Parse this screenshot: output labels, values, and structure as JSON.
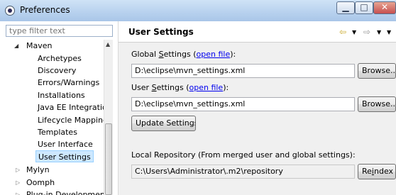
{
  "window": {
    "title": "Preferences",
    "minimize_glyph": "▁",
    "maximize_glyph": "□",
    "close_glyph": "✕"
  },
  "sidebar": {
    "filter_placeholder": "type filter text",
    "tree": [
      {
        "label": "Maven",
        "expanded": true
      },
      {
        "label": "Archetypes"
      },
      {
        "label": "Discovery"
      },
      {
        "label": "Errors/Warnings"
      },
      {
        "label": "Installations"
      },
      {
        "label": "Java EE Integration"
      },
      {
        "label": "Lifecycle Mapping"
      },
      {
        "label": "Templates"
      },
      {
        "label": "User Interface"
      },
      {
        "label": "User Settings",
        "selected": true
      },
      {
        "label": "Mylyn",
        "expanded": false
      },
      {
        "label": "Oomph",
        "expanded": false
      },
      {
        "label": "Plug-in Development",
        "expanded": false
      }
    ]
  },
  "page": {
    "title": "User Settings",
    "global": {
      "label_pre": "Global ",
      "label_mn": "S",
      "label_post": "ettings (",
      "link": "open file",
      "label_end": "):",
      "value": "D:\\eclipse\\mvn_settings.xml",
      "browse": "Browse..."
    },
    "user": {
      "label_pre": "User ",
      "label_mn": "S",
      "label_post": "ettings (",
      "link": "open file",
      "label_end": "):",
      "value": "D:\\eclipse\\mvn_settings.xml",
      "browse": "Browse..."
    },
    "update_button": "Update Settings",
    "local_repo": {
      "label": "Local Repository (From merged user and global settings):",
      "value": "C:\\Users\\Administrator\\.m2\\repository",
      "reindex_pre": "Re",
      "reindex_mn": "i",
      "reindex_post": "ndex"
    }
  },
  "icons": {
    "back": "back-arrow-icon",
    "forward": "forward-arrow-icon",
    "view_menu": "view-menu-icon",
    "expand": "expand-arrow-icon",
    "collapse": "collapse-arrow-icon"
  }
}
